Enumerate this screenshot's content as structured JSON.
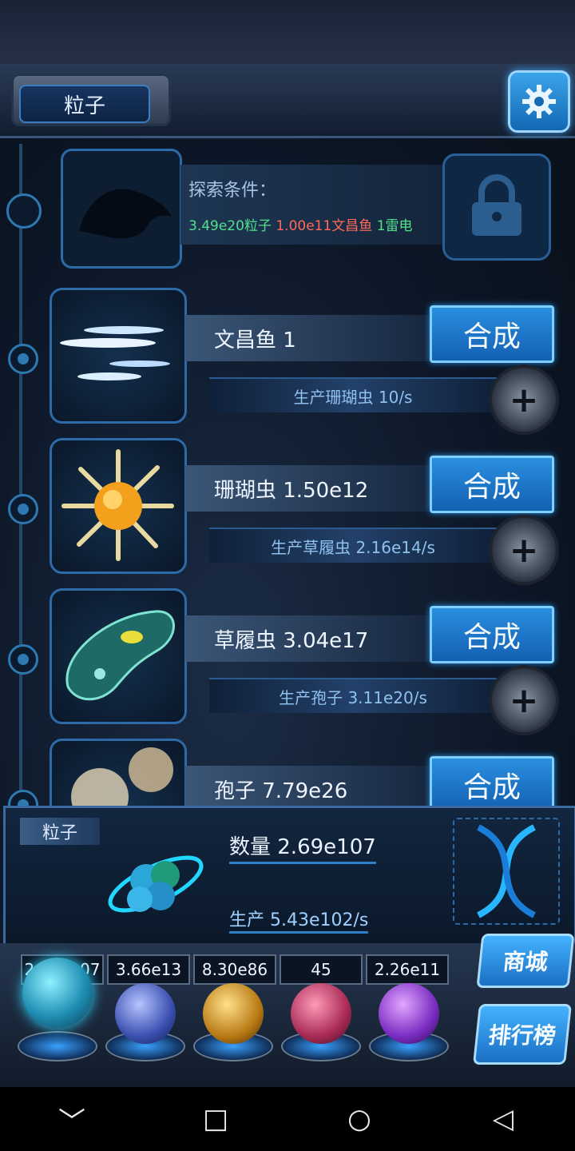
{
  "header": {
    "title": "粒子"
  },
  "explore": {
    "label": "探索条件：",
    "conditions": [
      {
        "text": "3.49e20粒子",
        "color": "#53e08a"
      },
      {
        "text": "1.00e11文昌鱼",
        "color": "#ff6a5a"
      },
      {
        "text": "1雷电",
        "color": "#53e08a"
      }
    ]
  },
  "rows": [
    {
      "name": "文昌鱼 1",
      "synth": "合成",
      "produce": "生产珊瑚虫 10/s",
      "icon": "lancelet-icon"
    },
    {
      "name": "珊瑚虫 1.50e12",
      "synth": "合成",
      "produce": "生产草履虫 2.16e14/s",
      "icon": "coral-polyp-icon"
    },
    {
      "name": "草履虫 3.04e17",
      "synth": "合成",
      "produce": "生产孢子 3.11e20/s",
      "icon": "paramecium-icon"
    },
    {
      "name": "孢子 7.79e26",
      "synth": "合成",
      "icon": "spore-icon"
    }
  ],
  "panel": {
    "tag": "粒子",
    "quantity": "数量 2.69e107",
    "production": "生产 5.43e102/s"
  },
  "dock": {
    "stats": [
      "2.69e107",
      "3.66e13",
      "8.30e86",
      "45",
      "2.26e11"
    ],
    "orbs": [
      {
        "icon": "particle-orb-icon",
        "color": "#2fb6d8"
      },
      {
        "icon": "lightning-orb-icon",
        "color": "#5a6fd6"
      },
      {
        "icon": "galaxy-orb-icon",
        "color": "#d89a2a"
      },
      {
        "icon": "brain-orb-icon",
        "color": "#c23a6a"
      },
      {
        "icon": "vortex-orb-icon",
        "color": "#8a3ad6"
      }
    ],
    "shop": "商城",
    "ranking": "排行榜"
  },
  "nav": {
    "back": "◁",
    "home": "○",
    "recent": "□",
    "down": "﹀"
  }
}
